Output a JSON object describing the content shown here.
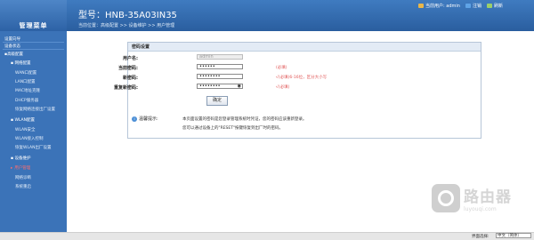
{
  "header": {
    "model_label": "型号：HNB-35A03IN35",
    "breadcrumb": "当前位置：高级配置 >> 设备维护 >> 用户管理",
    "current_user": "当前用户: admin",
    "logout": "注销",
    "refresh": "刷新"
  },
  "sidebar": {
    "title": "管理菜单",
    "items": [
      {
        "label": "设置向导"
      },
      {
        "label": "设备状态"
      },
      {
        "label": "高级配置"
      },
      {
        "label": "网络配置"
      },
      {
        "label": "WAN口配置"
      },
      {
        "label": "LAN口配置"
      },
      {
        "label": "MAC地址克隆"
      },
      {
        "label": "DHCP服务器"
      },
      {
        "label": "恢复网络连接出厂设置"
      },
      {
        "label": "WLAN配置"
      },
      {
        "label": "WLAN安全"
      },
      {
        "label": "WLAN接入控制"
      },
      {
        "label": "恢复WLAN出厂设置"
      },
      {
        "label": "设备维护"
      },
      {
        "label": "用户管理"
      },
      {
        "label": "网络诊断"
      },
      {
        "label": "系统重启"
      }
    ]
  },
  "form": {
    "title": "密码设置",
    "username_label": "用户名:",
    "username_value": "admin",
    "current_password_label": "当前密码:",
    "current_password_value": "••••••",
    "current_password_hint": "(必填)",
    "new_password_label": "新密码:",
    "new_password_value": "••••••••",
    "new_password_hint": "√(必填)6-16位，区分大小写",
    "confirm_password_label": "重复新密码:",
    "confirm_password_value": "••••••••",
    "confirm_password_hint": "√(必填)",
    "ok_button": "确定"
  },
  "tip": {
    "label": "温馨提示:",
    "line1": "本页面设置的密码是您登录管理系统时凭证，您的密码应该重新登录。",
    "line2": "您可以通过设备上的\"RESET\"按键恢复到出厂时的密码。"
  },
  "footer": {
    "language_label": "界面选择:",
    "language_value": "中文（简体）"
  },
  "watermark": {
    "brand_cn": "路由器",
    "brand_en": "luyouqi.com"
  }
}
